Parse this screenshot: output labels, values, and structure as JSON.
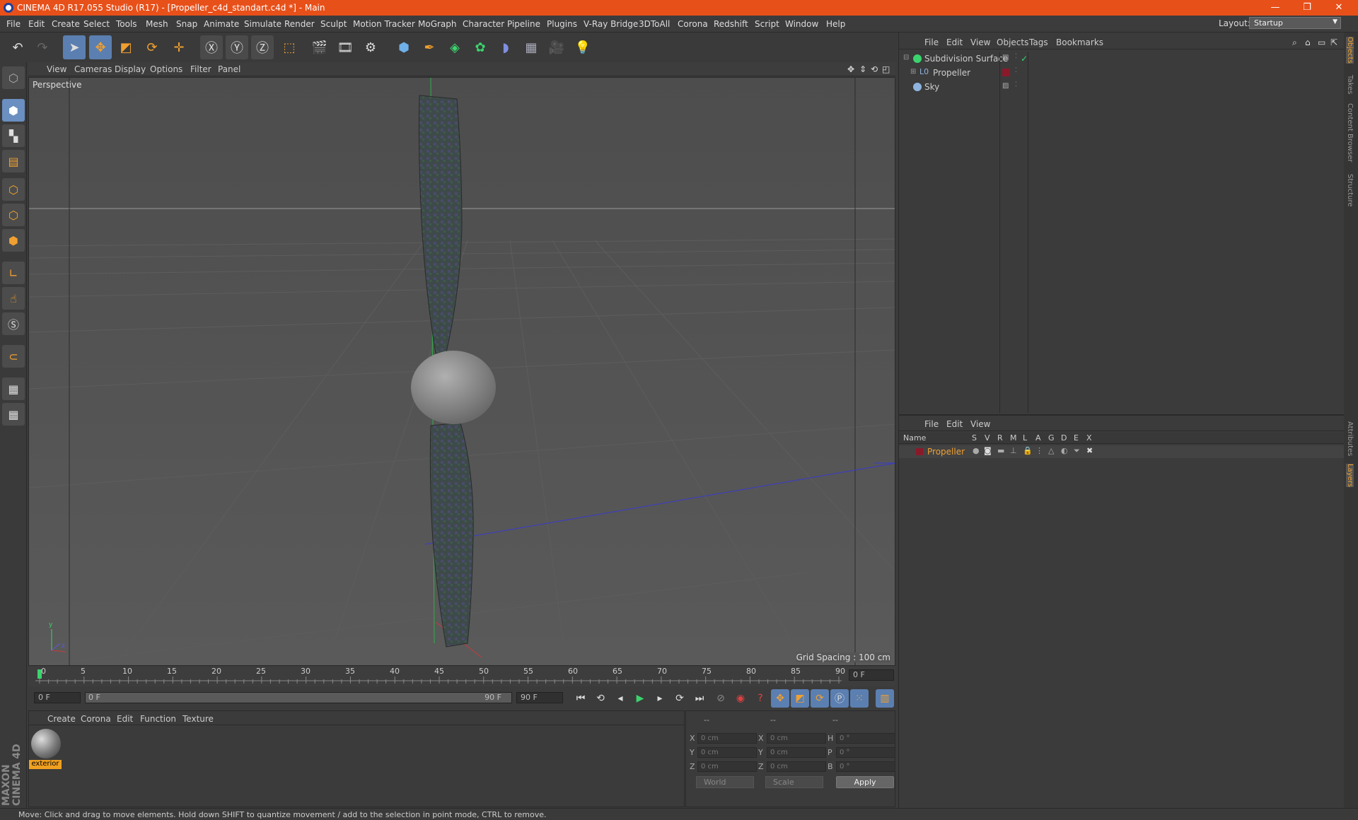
{
  "window": {
    "title": "CINEMA 4D R17.055 Studio (R17) - [Propeller_c4d_standart.c4d *] - Main",
    "minimize": "—",
    "maximize": "❐",
    "close": "✕"
  },
  "menu": [
    "File",
    "Edit",
    "Create",
    "Select",
    "Tools",
    "Mesh",
    "Snap",
    "Animate",
    "Simulate",
    "Render",
    "Sculpt",
    "Motion Tracker",
    "MoGraph",
    "Character",
    "Pipeline",
    "Plugins",
    "V-Ray Bridge",
    "3DToAll",
    "Corona",
    "Redshift",
    "Script",
    "Window",
    "Help"
  ],
  "layout": {
    "label": "Layout:",
    "value": "Startup"
  },
  "viewport": {
    "menu": [
      "View",
      "Cameras",
      "Display",
      "Options",
      "Filter",
      "Panel"
    ],
    "camera_label": "Perspective",
    "grid_spacing": "Grid Spacing : 100 cm"
  },
  "timeline": {
    "ticks": [
      "0",
      "5",
      "10",
      "15",
      "20",
      "25",
      "30",
      "35",
      "40",
      "45",
      "50",
      "55",
      "60",
      "65",
      "70",
      "75",
      "80",
      "85",
      "90"
    ],
    "end_field": "0 F",
    "current_frame": 0,
    "max_frame": 90
  },
  "frame_controls": {
    "start": "0 F",
    "range_start": "0 F",
    "range_end": "90 F",
    "end": "90 F"
  },
  "material_panel": {
    "menu": [
      "Create",
      "Corona",
      "Edit",
      "Function",
      "Texture"
    ],
    "material_name": "exterior"
  },
  "coordinates": {
    "headers": [
      "--",
      "--",
      "--"
    ],
    "rows": [
      {
        "a": "X",
        "av": "0 cm",
        "b": "X",
        "bv": "0 cm",
        "c": "H",
        "cv": "0 °"
      },
      {
        "a": "Y",
        "av": "0 cm",
        "b": "Y",
        "bv": "0 cm",
        "c": "P",
        "cv": "0 °"
      },
      {
        "a": "Z",
        "av": "0 cm",
        "b": "Z",
        "bv": "0 cm",
        "c": "B",
        "cv": "0 °"
      }
    ],
    "space": "World",
    "mode": "Scale",
    "apply": "Apply"
  },
  "object_manager": {
    "menu": [
      "File",
      "Edit",
      "View",
      "Objects",
      "Tags",
      "Bookmarks"
    ],
    "objects": [
      {
        "name": "Subdivision Surface",
        "color": "#3bd36e"
      },
      {
        "name": "Propeller",
        "color": "#8fb4e0"
      },
      {
        "name": "Sky",
        "color": "#8fb4e0"
      }
    ]
  },
  "layer_manager": {
    "menu": [
      "File",
      "Edit",
      "View"
    ],
    "columns": [
      "Name",
      "S",
      "V",
      "R",
      "M",
      "L",
      "A",
      "G",
      "D",
      "E",
      "X"
    ],
    "layers": [
      {
        "name": "Propeller",
        "color": "#8a1a2a"
      }
    ]
  },
  "side_tabs": [
    "Objects",
    "Takes",
    "Content Browser",
    "Structure",
    "Attributes",
    "Layers"
  ],
  "brand": "MAXON CINEMA 4D",
  "status": "Move: Click and drag to move elements. Hold down SHIFT to quantize movement / add to the selection in point mode, CTRL to remove.",
  "colors": {
    "titlebar": "#e8501a",
    "accent": "#5b7fb0",
    "highlight": "#f0a030"
  }
}
